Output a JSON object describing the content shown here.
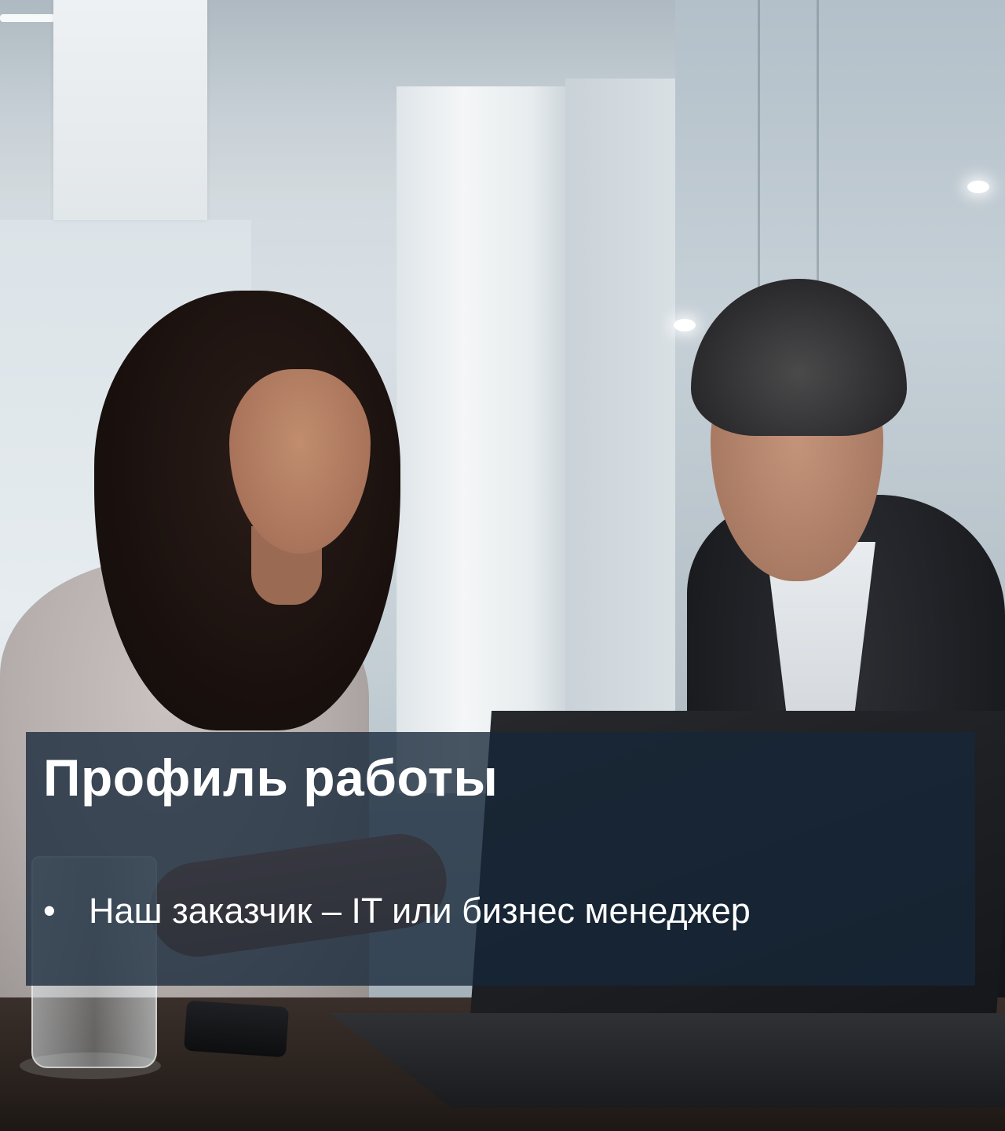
{
  "slide": {
    "title": "Профиль работы",
    "bullet_symbol": "•",
    "bullets": [
      "Наш заказчик – IT или бизнес менеджер"
    ]
  },
  "colors": {
    "overlay": "#162638",
    "text": "#ffffff"
  }
}
